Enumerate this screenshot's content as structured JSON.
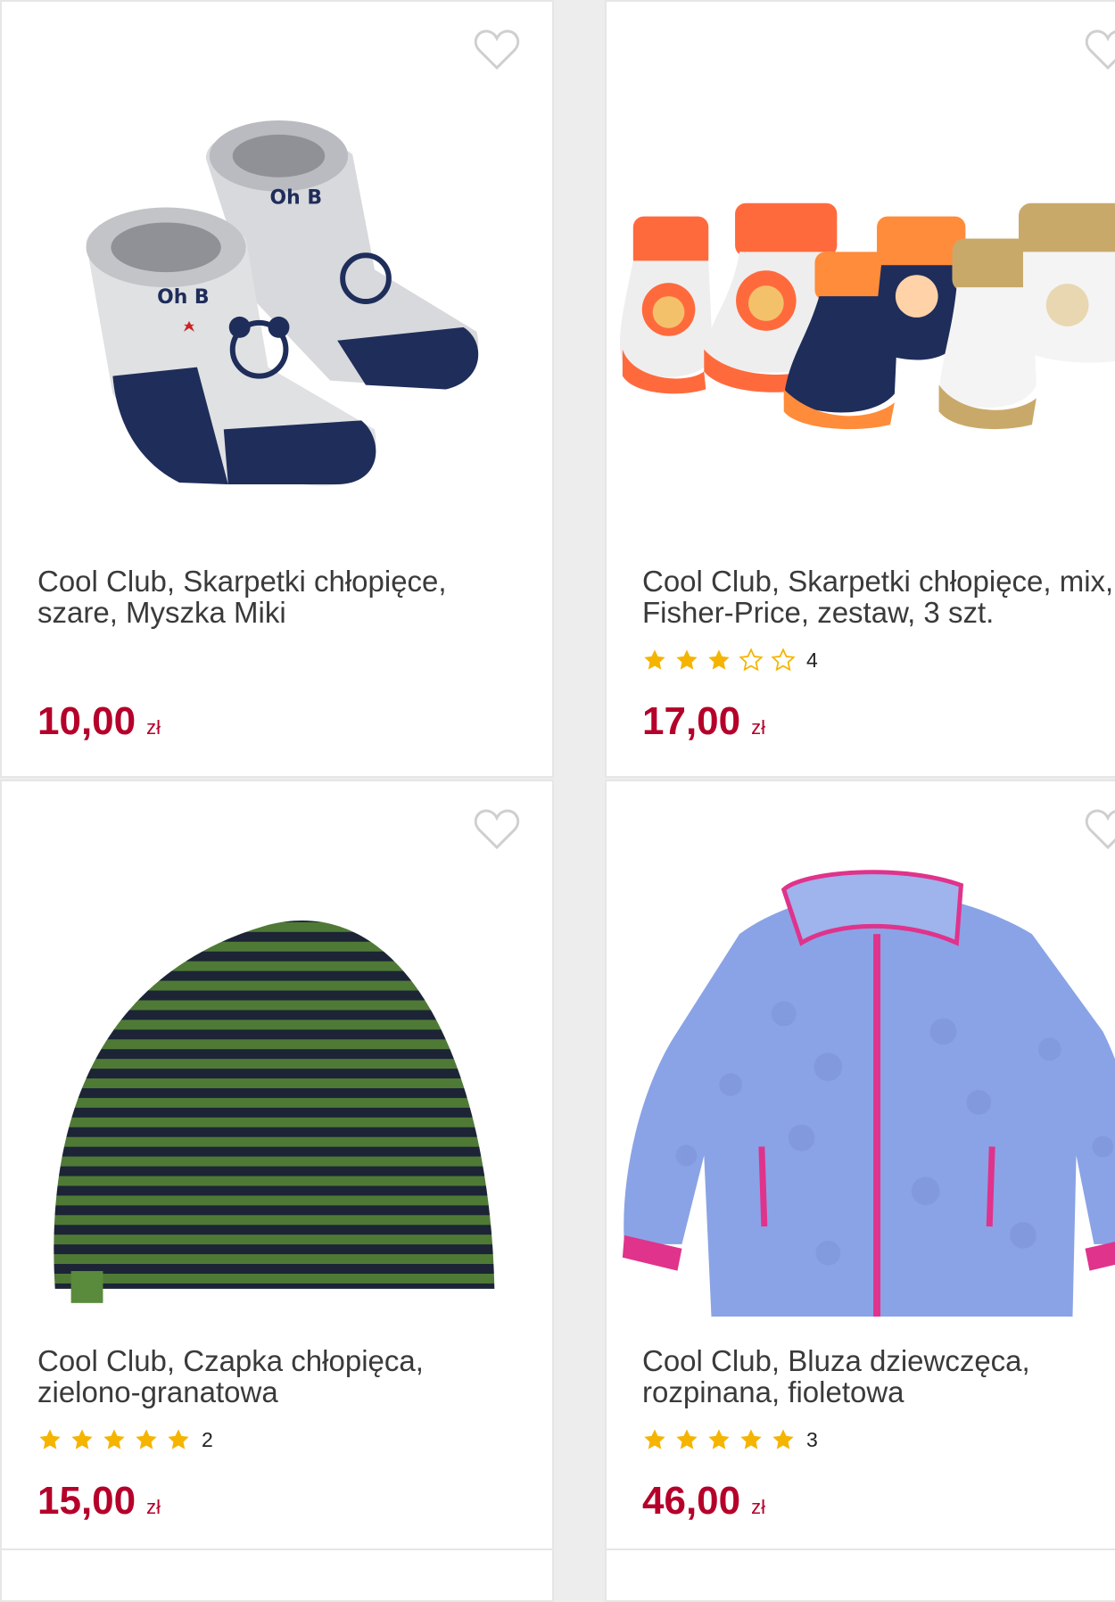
{
  "colors": {
    "accent": "#b5002a",
    "star": "#f5b400",
    "card_bg": "#ffffff",
    "page_bg": "#ededed"
  },
  "products": [
    {
      "title": "Cool Club, Skarpetki chłopięce,\nszare, Myszka Miki",
      "price": "10,00",
      "currency": "zł",
      "rating": null,
      "rating_count": null
    },
    {
      "title": "Cool Club, Skarpetki chłopięce, mix,\nFisher-Price, zestaw, 3 szt.",
      "price": "17,00",
      "currency": "zł",
      "rating": 3,
      "rating_count": "4"
    },
    {
      "title": "Cool Club, Czapka chłopięca,\nzielono-granatowa",
      "price": "15,00",
      "currency": "zł",
      "rating": 5,
      "rating_count": "2"
    },
    {
      "title": "Cool Club, Bluza dziewczęca,\nrozpinana, fioletowa",
      "price": "46,00",
      "currency": "zł",
      "rating": 5,
      "rating_count": "3"
    }
  ],
  "icons": {
    "wishlist": "heart-outline-icon",
    "star_full": "star-filled-icon",
    "star_empty": "star-outline-icon"
  }
}
